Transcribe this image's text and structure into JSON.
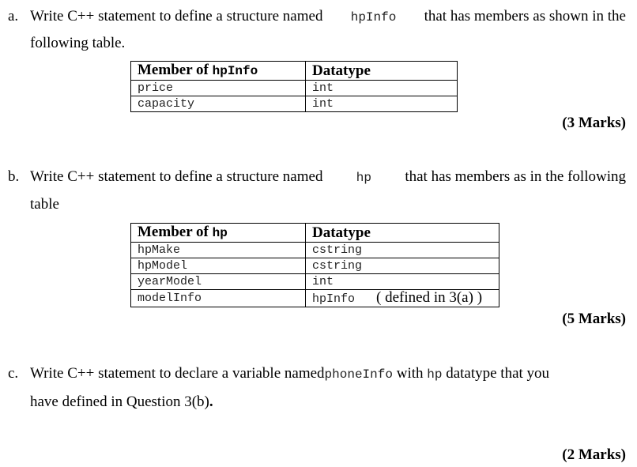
{
  "questions": [
    {
      "label": "a.",
      "line1": {
        "pre": "Write C++ statement to define a structure named",
        "code": "hpInfo",
        "post": "that has members as shown in the"
      },
      "line2": "following table.",
      "table": {
        "header_member_prefix": "Member of",
        "header_member_code": "hpInfo",
        "header_datatype": "Datatype",
        "rows": [
          {
            "member": "price",
            "datatype": "int"
          },
          {
            "member": "capacity",
            "datatype": "int"
          }
        ]
      },
      "marks": "(3 Marks)"
    },
    {
      "label": "b.",
      "line1": {
        "pre": "Write C++ statement to define a structure named",
        "code": "hp",
        "post": "that has members as in the following"
      },
      "line2": "table",
      "table": {
        "header_member_prefix": "Member of",
        "header_member_code": "hp",
        "header_datatype": "Datatype",
        "rows": [
          {
            "member": "hpMake",
            "datatype": "cstring",
            "note": ""
          },
          {
            "member": "hpModel",
            "datatype": "cstring",
            "note": ""
          },
          {
            "member": "yearModel",
            "datatype": "int",
            "note": ""
          },
          {
            "member": "modelInfo",
            "datatype": "hpInfo",
            "note": "( defined in 3(a) )"
          }
        ]
      },
      "marks": "(5 Marks)"
    },
    {
      "label": "c.",
      "line1": {
        "pre": "Write C++ statement to declare a variable  named",
        "code1": "phoneInfo",
        "mid": "with",
        "code2": "hp",
        "post": "datatype that you"
      },
      "line2_pre": "have defined in Question 3(b)",
      "line2_post": ".",
      "marks": "(2 Marks)"
    }
  ]
}
